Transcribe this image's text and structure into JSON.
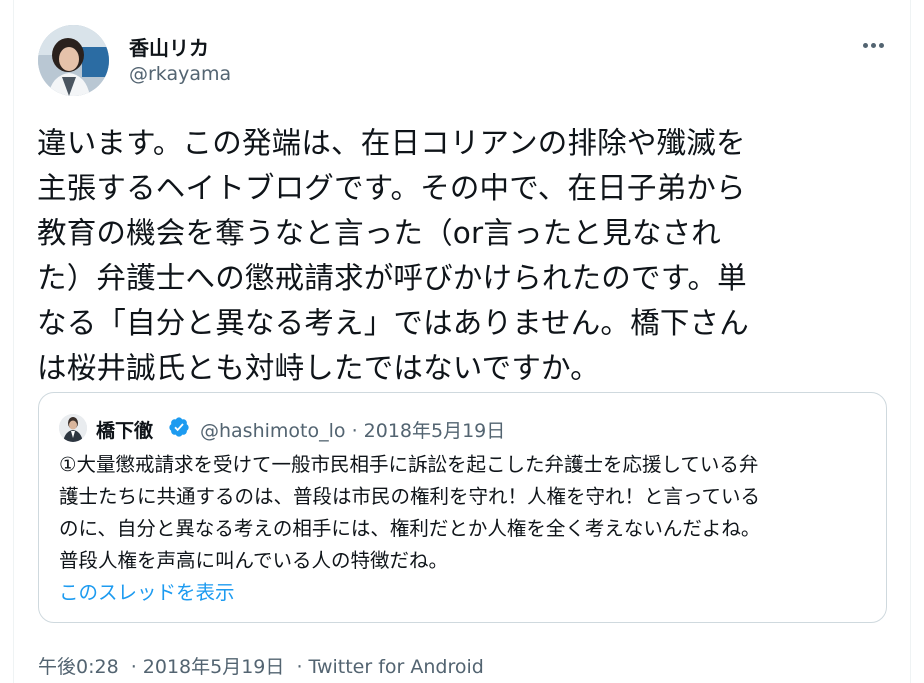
{
  "tweet": {
    "author_name": "香山リカ",
    "author_handle": "@rkayama",
    "more_icon": "more-horizontal-icon",
    "body_lines": [
      "違います。この発端は、在日コリアンの排除や殲滅を",
      "主張するヘイトブログです。その中で、在日子弟から",
      "教育の機会を奪うなと言った（or言ったと見なされ",
      "た）弁護士への懲戒請求が呼びかけられたのです。単",
      "なる「自分と異なる考え」ではありません。橋下さん",
      "は桜井誠氏とも対峙したではないですか。"
    ],
    "footer": {
      "time": "午後0:28",
      "separator": "·",
      "date": "2018年5月19日",
      "source": "Twitter for Android"
    }
  },
  "quoted": {
    "author_name": "橋下徹",
    "verified_icon": "verified-badge-icon",
    "author_handle": "@hashimoto_lo",
    "separator": "·",
    "date": "2018年5月19日",
    "text_lines": [
      "①大量懲戒請求を受けて一般市民相手に訴訟を起こした弁護士を応援している弁",
      "護士たちに共通するのは、普段は市民の権利を守れ！人権を守れ！と言っている",
      "のに、自分と異なる考えの相手には、権利だとか人権を全く考えないんだよね。",
      "普段人権を声高に叫んでいる人の特徴だね。"
    ],
    "show_thread_label": "このスレッドを表示"
  },
  "colors": {
    "text_primary": "#0f1419",
    "text_secondary": "#536471",
    "link": "#1d9bf0",
    "border": "#cfd9de"
  }
}
